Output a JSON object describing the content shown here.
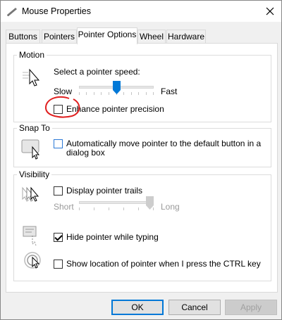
{
  "window": {
    "title": "Mouse Properties"
  },
  "tabs": [
    {
      "label": "Buttons",
      "active": false
    },
    {
      "label": "Pointers",
      "active": false
    },
    {
      "label": "Pointer Options",
      "active": true
    },
    {
      "label": "Wheel",
      "active": false
    },
    {
      "label": "Hardware",
      "active": false
    }
  ],
  "motion": {
    "group_label": "Motion",
    "speed_label": "Select a pointer speed:",
    "slow_label": "Slow",
    "fast_label": "Fast",
    "speed_value": 0.5,
    "precision_label": "Enhance pointer precision",
    "precision_checked": false
  },
  "snap_to": {
    "group_label": "Snap To",
    "auto_move_label_line1": "Automatically move pointer to the default button in a",
    "auto_move_label_line2": "dialog box",
    "auto_move_checked": false
  },
  "visibility": {
    "group_label": "Visibility",
    "trails_label": "Display pointer trails",
    "trails_checked": false,
    "short_label": "Short",
    "long_label": "Long",
    "trail_length_value": 1.0,
    "hide_label": "Hide pointer while typing",
    "hide_checked": true,
    "show_location_label": "Show location of pointer when I press the CTRL key",
    "show_location_checked": false
  },
  "buttons": {
    "ok": "OK",
    "cancel": "Cancel",
    "apply": "Apply"
  },
  "colors": {
    "accent": "#0078d7",
    "slider_thumb": "#0078d7",
    "annotation": "#e02020"
  }
}
